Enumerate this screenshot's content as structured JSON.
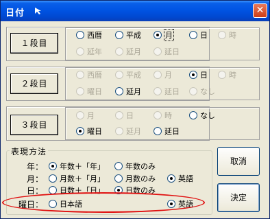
{
  "window": {
    "title": "日付",
    "close_symbol": "✕"
  },
  "rows": [
    {
      "label": "１段目",
      "options": [
        {
          "label": "西暦",
          "checked": false,
          "disabled": false
        },
        {
          "label": "平成",
          "checked": false,
          "disabled": false
        },
        {
          "label": "月",
          "checked": true,
          "disabled": false,
          "focused": true
        },
        {
          "label": "日",
          "checked": false,
          "disabled": false
        },
        {
          "label": "時",
          "checked": false,
          "disabled": true
        },
        {
          "label": "延年",
          "checked": false,
          "disabled": true
        },
        {
          "label": "延月",
          "checked": false,
          "disabled": true
        },
        {
          "label": "延日",
          "checked": false,
          "disabled": true
        }
      ]
    },
    {
      "label": "２段目",
      "options": [
        {
          "label": "西暦",
          "checked": false,
          "disabled": true
        },
        {
          "label": "平成",
          "checked": false,
          "disabled": true
        },
        {
          "label": "月",
          "checked": false,
          "disabled": true
        },
        {
          "label": "日",
          "checked": true,
          "disabled": false
        },
        {
          "label": "時",
          "checked": false,
          "disabled": true
        },
        {
          "label": "曜日",
          "checked": false,
          "disabled": true
        },
        {
          "label": "延月",
          "checked": false,
          "disabled": false
        },
        {
          "label": "延日",
          "checked": false,
          "disabled": true
        },
        {
          "label": "なし",
          "checked": false,
          "disabled": true
        }
      ]
    },
    {
      "label": "３段目",
      "options": [
        {
          "label": "月",
          "checked": false,
          "disabled": true
        },
        {
          "label": "日",
          "checked": false,
          "disabled": true
        },
        {
          "label": "時",
          "checked": false,
          "disabled": true
        },
        {
          "label": "なし",
          "checked": false,
          "disabled": false
        },
        {
          "label": "曜日",
          "checked": true,
          "disabled": false
        },
        {
          "label": "延月",
          "checked": false,
          "disabled": true
        },
        {
          "label": "延日",
          "checked": false,
          "disabled": false
        }
      ]
    }
  ],
  "expression": {
    "title": "表現方法",
    "year": {
      "label": "年：",
      "options": [
        "年数＋「年」",
        "年数のみ"
      ],
      "selected": 0
    },
    "month": {
      "label": "月：",
      "options": [
        "月数＋「月」",
        "月数のみ",
        "英語"
      ],
      "selected": 2
    },
    "day": {
      "label": "日：",
      "options": [
        "日数＋「日」",
        "日数のみ"
      ],
      "selected": 1
    },
    "weekday": {
      "label": "曜日：",
      "options": [
        "日本語",
        "英語"
      ],
      "selected": 1
    }
  },
  "buttons": {
    "cancel": "取消",
    "ok": "決定"
  },
  "colors": {
    "titlebar": "#0054e3",
    "dialog_bg": "#ece9d8",
    "annotation": "#e01010",
    "radio_dot": "#21a121"
  }
}
